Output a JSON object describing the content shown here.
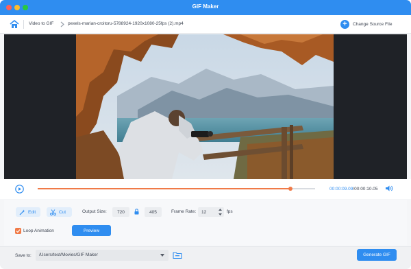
{
  "window": {
    "title": "GIF Maker"
  },
  "nav": {
    "breadcrumb_root": "Video to GIF",
    "file_name": "pexels-marian-croitoru-5788924-1920x1080-25fps (2).mp4",
    "change_source_label": "Change Source File"
  },
  "player": {
    "current_time": "00:00:09.09",
    "separator": "/",
    "total_time": "00:00:10.05",
    "progress_fraction": 0.91
  },
  "settings": {
    "edit_label": "Edit",
    "cut_label": "Cut",
    "output_size_label": "Output Size:",
    "width": "720",
    "height": "405",
    "frame_rate_label": "Frame Rate:",
    "frame_rate": "12",
    "fps_label": "fps",
    "loop_label": "Loop Animation",
    "loop_checked": true,
    "preview_label": "Preview"
  },
  "footer": {
    "save_to_label": "Save to:",
    "save_path": "/Users/test/Movies/GIF Maker",
    "generate_label": "Generate GIF"
  },
  "colors": {
    "accent": "#2f8df0",
    "progress": "#f07a47"
  },
  "icons": {
    "home": "home-icon",
    "chevron": "chevron-right-icon",
    "add": "plus-circle-icon",
    "play": "play-icon",
    "volume": "volume-icon",
    "edit": "magic-wand-icon",
    "cut": "scissors-icon",
    "lock": "lock-icon",
    "folder": "folder-icon"
  }
}
